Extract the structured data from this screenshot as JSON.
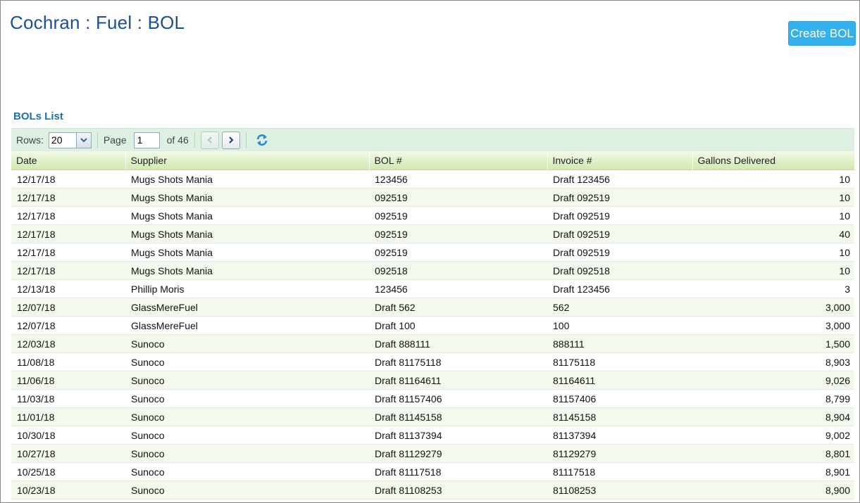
{
  "header": {
    "title": "Cochran : Fuel : BOL",
    "create_button": "Create BOL"
  },
  "list": {
    "title": "BOLs List"
  },
  "toolbar": {
    "rows_label": "Rows:",
    "rows_value": "20",
    "page_label": "Page",
    "page_value": "1",
    "of_text": "of 46",
    "icons": [
      "chevron-down-icon",
      "chevron-left-icon",
      "chevron-right-icon",
      "refresh-icon"
    ]
  },
  "table": {
    "columns": [
      "Date",
      "Supplier",
      "BOL #",
      "Invoice #",
      "Gallons Delivered"
    ],
    "rows": [
      [
        "12/17/18",
        "Mugs Shots Mania",
        "123456",
        "Draft 123456",
        "10"
      ],
      [
        "12/17/18",
        "Mugs Shots Mania",
        "092519",
        "Draft 092519",
        "10"
      ],
      [
        "12/17/18",
        "Mugs Shots Mania",
        "092519",
        "Draft 092519",
        "10"
      ],
      [
        "12/17/18",
        "Mugs Shots Mania",
        "092519",
        "Draft 092519",
        "40"
      ],
      [
        "12/17/18",
        "Mugs Shots Mania",
        "092519",
        "Draft 092519",
        "10"
      ],
      [
        "12/17/18",
        "Mugs Shots Mania",
        "092518",
        "Draft 092518",
        "10"
      ],
      [
        "12/13/18",
        "Phillip Moris",
        "123456",
        "Draft 123456",
        "3"
      ],
      [
        "12/07/18",
        "GlassMereFuel",
        "Draft 562",
        "562",
        "3,000"
      ],
      [
        "12/07/18",
        "GlassMereFuel",
        "Draft 100",
        "100",
        "3,000"
      ],
      [
        "12/03/18",
        "Sunoco",
        "Draft 888111",
        "888111",
        "1,500"
      ],
      [
        "11/08/18",
        "Sunoco",
        "Draft 81175118",
        "81175118",
        "8,903"
      ],
      [
        "11/06/18",
        "Sunoco",
        "Draft 81164611",
        "81164611",
        "9,026"
      ],
      [
        "11/03/18",
        "Sunoco",
        "Draft 81157406",
        "81157406",
        "8,799"
      ],
      [
        "11/01/18",
        "Sunoco",
        "Draft 81145158",
        "81145158",
        "8,904"
      ],
      [
        "10/30/18",
        "Sunoco",
        "Draft 81137394",
        "81137394",
        "9,002"
      ],
      [
        "10/27/18",
        "Sunoco",
        "Draft 81129279",
        "81129279",
        "8,801"
      ],
      [
        "10/25/18",
        "Sunoco",
        "Draft 81117518",
        "81117518",
        "8,901"
      ],
      [
        "10/23/18",
        "Sunoco",
        "Draft 81108253",
        "81108253",
        "8,900"
      ]
    ]
  },
  "colors": {
    "title": "#1b4f9c",
    "button": "#33b0ee",
    "list_title": "#1d6fae",
    "toolbar_bg": "#ddf1e3",
    "header_bg": "#d2e8b1",
    "row_alt": "#f4f9ee"
  }
}
